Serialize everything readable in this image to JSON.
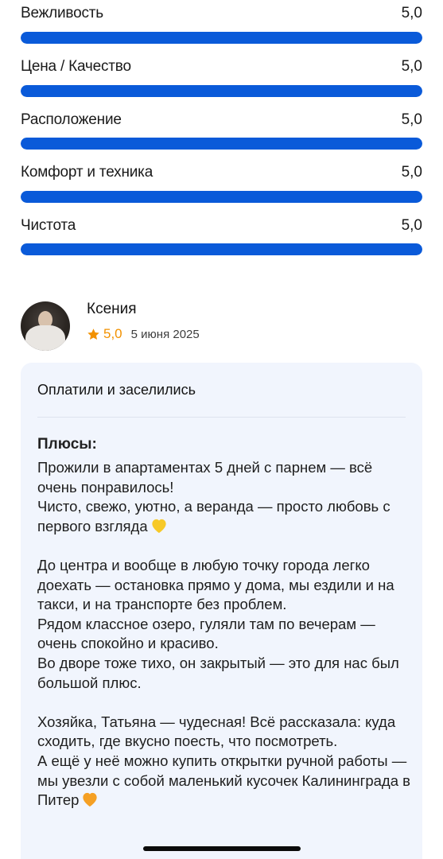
{
  "ratings": [
    {
      "label": "Вежливость",
      "value": "5,0",
      "fill": 1.0
    },
    {
      "label": "Цена / Качество",
      "value": "5,0",
      "fill": 1.0
    },
    {
      "label": "Расположение",
      "value": "5,0",
      "fill": 1.0
    },
    {
      "label": "Комфорт и техника",
      "value": "5,0",
      "fill": 1.0
    },
    {
      "label": "Чистота",
      "value": "5,0",
      "fill": 1.0
    }
  ],
  "review": {
    "author": "Ксения",
    "score": "5,0",
    "date": "5 июня 2025",
    "title": "Оплатили и заселились",
    "pros_heading": "Плюсы:",
    "paragraphs": {
      "p1": "Прожили в апартаментах 5 дней с парнем — всё очень понравилось!",
      "p2": "Чисто, свежо, уютно, а веранда — просто любовь с первого взгляда",
      "p3": "До центра и вообще в любую точку города легко доехать — остановка прямо у дома, мы ездили и на такси, и на транспорте без проблем.",
      "p4": "Рядом классное озеро, гуляли там по вечерам — очень спокойно и красиво.",
      "p5": "Во дворе тоже тихо, он закрытый — это для нас был большой плюс.",
      "p6": "Хозяйка, Татьяна — чудесная! Всё рассказала: куда сходить, где вкусно поесть, что посмотреть.",
      "p7": "А ещё у неё можно купить открытки ручной работы — мы увезли с собой маленький кусочек Калининграда в Питер"
    }
  },
  "icons": {
    "star": "star-icon",
    "yellow_heart": "yellow-heart-emoji",
    "orange_heart": "orange-heart-emoji"
  },
  "colors": {
    "bar_fill": "#0a5ad9",
    "bar_track": "#e4ebf7",
    "star": "#f29100",
    "card_bg": "#f1f5fd",
    "yellow_heart": "#f7c928",
    "orange_heart": "#f5a024"
  }
}
